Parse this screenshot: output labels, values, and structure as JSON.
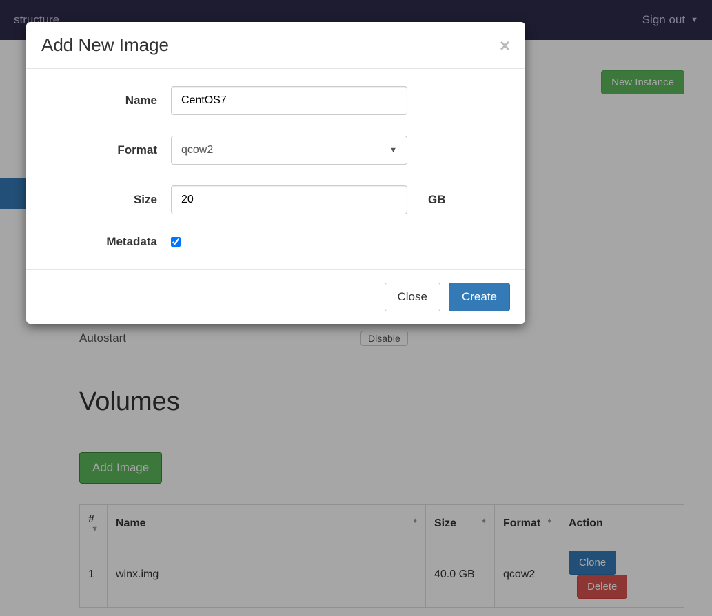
{
  "nav": {
    "left_partial": "structure",
    "signout": "Sign out"
  },
  "header": {
    "new_instance": "New Instance"
  },
  "autostart": {
    "label": "Autostart",
    "state": "Disable"
  },
  "volumes": {
    "title": "Volumes",
    "add_image": "Add Image",
    "columns": {
      "num": "#",
      "name": "Name",
      "size": "Size",
      "format": "Format",
      "action": "Action"
    },
    "rows": [
      {
        "num": "1",
        "name": "winx.img",
        "size": "40.0 GB",
        "format": "qcow2"
      }
    ],
    "actions": {
      "clone": "Clone",
      "delete": "Delete"
    }
  },
  "modal": {
    "title": "Add New Image",
    "labels": {
      "name": "Name",
      "format": "Format",
      "size": "Size",
      "metadata": "Metadata"
    },
    "values": {
      "name": "CentOS7",
      "format": "qcow2",
      "size": "20",
      "size_unit": "GB",
      "metadata_checked": true
    },
    "buttons": {
      "close": "Close",
      "create": "Create"
    }
  }
}
